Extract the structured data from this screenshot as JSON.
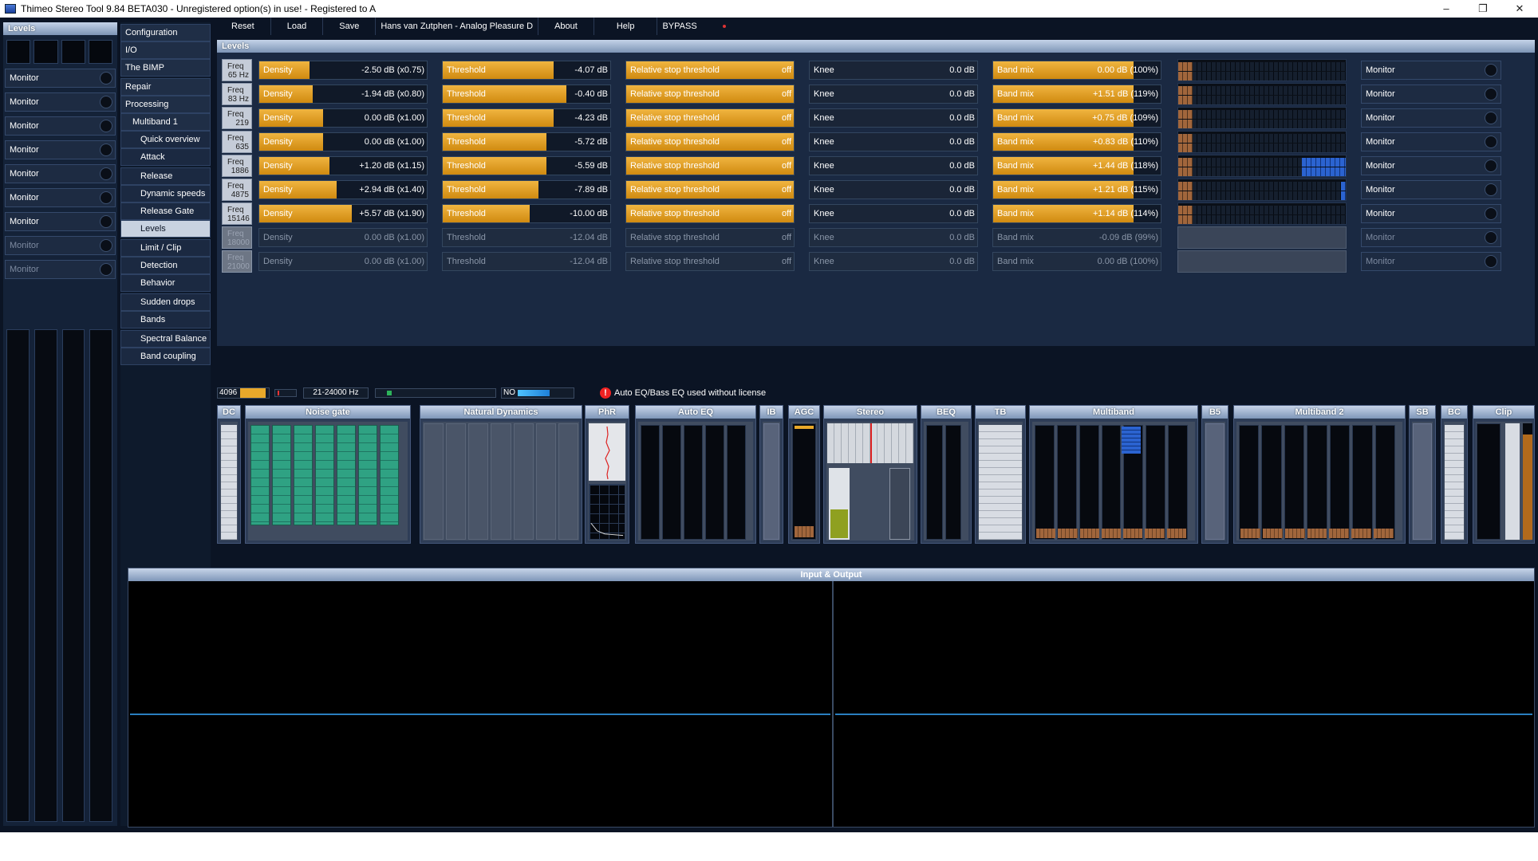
{
  "window": {
    "title": "Thimeo Stereo Tool 9.84 BETA030 - Unregistered option(s) in use! - Registered to A",
    "min": "–",
    "max": "❐",
    "close": "✕"
  },
  "toolbar": {
    "reset": "Reset",
    "load": "Load",
    "save": "Save",
    "preset": "Hans van Zutphen - Analog Pleasure D",
    "about": "About",
    "help": "Help",
    "bypass": "BYPASS"
  },
  "left_panel": {
    "title": "Levels",
    "monitors": [
      "Monitor",
      "Monitor",
      "Monitor",
      "Monitor",
      "Monitor",
      "Monitor",
      "Monitor",
      "Monitor",
      "Monitor"
    ]
  },
  "nav": {
    "items": [
      {
        "label": "Configuration",
        "level": 0,
        "selected": false
      },
      {
        "label": "I/O",
        "level": 0,
        "selected": false
      },
      {
        "label": "The BIMP",
        "level": 0,
        "selected": false
      },
      {
        "label": "Repair",
        "level": 0,
        "selected": false
      },
      {
        "label": "Processing",
        "level": 0,
        "selected": false
      },
      {
        "label": "Multiband 1",
        "level": 1,
        "selected": false
      },
      {
        "label": "Quick overview",
        "level": 2,
        "selected": false
      },
      {
        "label": "Attack",
        "level": 2,
        "selected": false
      },
      {
        "label": "Release",
        "level": 2,
        "selected": false
      },
      {
        "label": "Dynamic speeds",
        "level": 2,
        "selected": false
      },
      {
        "label": "Release Gate",
        "level": 2,
        "selected": false
      },
      {
        "label": "Levels",
        "level": 2,
        "selected": true
      },
      {
        "label": "Limit / Clip",
        "level": 2,
        "selected": false
      },
      {
        "label": "Detection",
        "level": 2,
        "selected": false
      },
      {
        "label": "Behavior",
        "level": 2,
        "selected": false
      },
      {
        "label": "Sudden drops",
        "level": 2,
        "selected": false
      },
      {
        "label": "Bands",
        "level": 2,
        "selected": false
      },
      {
        "label": "Spectral Balance",
        "level": 2,
        "selected": false
      },
      {
        "label": "Band coupling",
        "level": 2,
        "selected": false
      }
    ]
  },
  "levels": {
    "title": "Levels",
    "labels": {
      "freq": "Freq",
      "density": "Density",
      "threshold": "Threshold",
      "relstop": "Relative stop threshold",
      "knee": "Knee",
      "bandmix": "Band mix",
      "monitor": "Monitor"
    },
    "bands": [
      {
        "freq": "65 Hz",
        "density": "-2.50 dB (x0.75)",
        "density_fill": 0.3,
        "threshold": "-4.07 dB",
        "threshold_fill": 0.66,
        "relstop": "off",
        "knee": "0.0 dB",
        "bandmix": "0.00 dB (100%)",
        "bandmix_fill": 0.84,
        "meter_top": 0.0,
        "meter_bot": 0.0,
        "active": true
      },
      {
        "freq": "83 Hz",
        "density": "-1.94 dB (x0.80)",
        "density_fill": 0.32,
        "threshold": "-0.40 dB",
        "threshold_fill": 0.74,
        "relstop": "off",
        "knee": "0.0 dB",
        "bandmix": "+1.51 dB (119%)",
        "bandmix_fill": 0.84,
        "meter_top": 0.0,
        "meter_bot": 0.0,
        "active": true
      },
      {
        "freq": "219",
        "density": "0.00 dB (x1.00)",
        "density_fill": 0.38,
        "threshold": "-4.23 dB",
        "threshold_fill": 0.66,
        "relstop": "off",
        "knee": "0.0 dB",
        "bandmix": "+0.75 dB (109%)",
        "bandmix_fill": 0.84,
        "meter_top": 0.0,
        "meter_bot": 0.0,
        "active": true
      },
      {
        "freq": "635",
        "density": "0.00 dB (x1.00)",
        "density_fill": 0.38,
        "threshold": "-5.72 dB",
        "threshold_fill": 0.62,
        "relstop": "off",
        "knee": "0.0 dB",
        "bandmix": "+0.83 dB (110%)",
        "bandmix_fill": 0.84,
        "meter_top": 0.0,
        "meter_bot": 0.0,
        "active": true
      },
      {
        "freq": "1886",
        "density": "+1.20 dB (x1.15)",
        "density_fill": 0.42,
        "threshold": "-5.59 dB",
        "threshold_fill": 0.62,
        "relstop": "off",
        "knee": "0.0 dB",
        "bandmix": "+1.44 dB (118%)",
        "bandmix_fill": 0.84,
        "meter_top": 0.26,
        "meter_bot": 0.26,
        "active": true
      },
      {
        "freq": "4875",
        "density": "+2.94 dB (x1.40)",
        "density_fill": 0.46,
        "threshold": "-7.89 dB",
        "threshold_fill": 0.57,
        "relstop": "off",
        "knee": "0.0 dB",
        "bandmix": "+1.21 dB (115%)",
        "bandmix_fill": 0.84,
        "meter_top": 0.03,
        "meter_bot": 0.03,
        "active": true
      },
      {
        "freq": "15146",
        "density": "+5.57 dB (x1.90)",
        "density_fill": 0.55,
        "threshold": "-10.00 dB",
        "threshold_fill": 0.52,
        "relstop": "off",
        "knee": "0.0 dB",
        "bandmix": "+1.14 dB (114%)",
        "bandmix_fill": 0.84,
        "meter_top": 0.0,
        "meter_bot": 0.0,
        "active": true
      },
      {
        "freq": "18000",
        "density": "0.00 dB (x1.00)",
        "density_fill": 0.0,
        "threshold": "-12.04 dB",
        "threshold_fill": 0.0,
        "relstop": "off",
        "knee": "0.0 dB",
        "bandmix": "-0.09 dB (99%)",
        "bandmix_fill": 0.0,
        "meter_top": 0.0,
        "meter_bot": 0.0,
        "active": false
      },
      {
        "freq": "21000",
        "density": "0.00 dB (x1.00)",
        "density_fill": 0.0,
        "threshold": "-12.04 dB",
        "threshold_fill": 0.0,
        "relstop": "off",
        "knee": "0.0 dB",
        "bandmix": "0.00 dB (100%)",
        "bandmix_fill": 0.0,
        "meter_top": 0.0,
        "meter_bot": 0.0,
        "active": false
      }
    ]
  },
  "status": {
    "buffer": "4096",
    "range": "21-24000 Hz",
    "no": "NO",
    "warning": "Auto EQ/Bass EQ used without license"
  },
  "modules": [
    "DC",
    "Noise gate",
    "Natural Dynamics",
    "PhR",
    "Auto EQ",
    "IB",
    "AGC",
    "Stereo",
    "BEQ",
    "TB",
    "Multiband",
    "B5",
    "Multiband 2",
    "SB",
    "BC",
    "Clip"
  ],
  "io": {
    "title": "Input & Output"
  },
  "colors": {
    "accent": "#e8a82a",
    "bg": "#0b1424",
    "panel": "#1a2942",
    "header": "#9fb3cf"
  }
}
